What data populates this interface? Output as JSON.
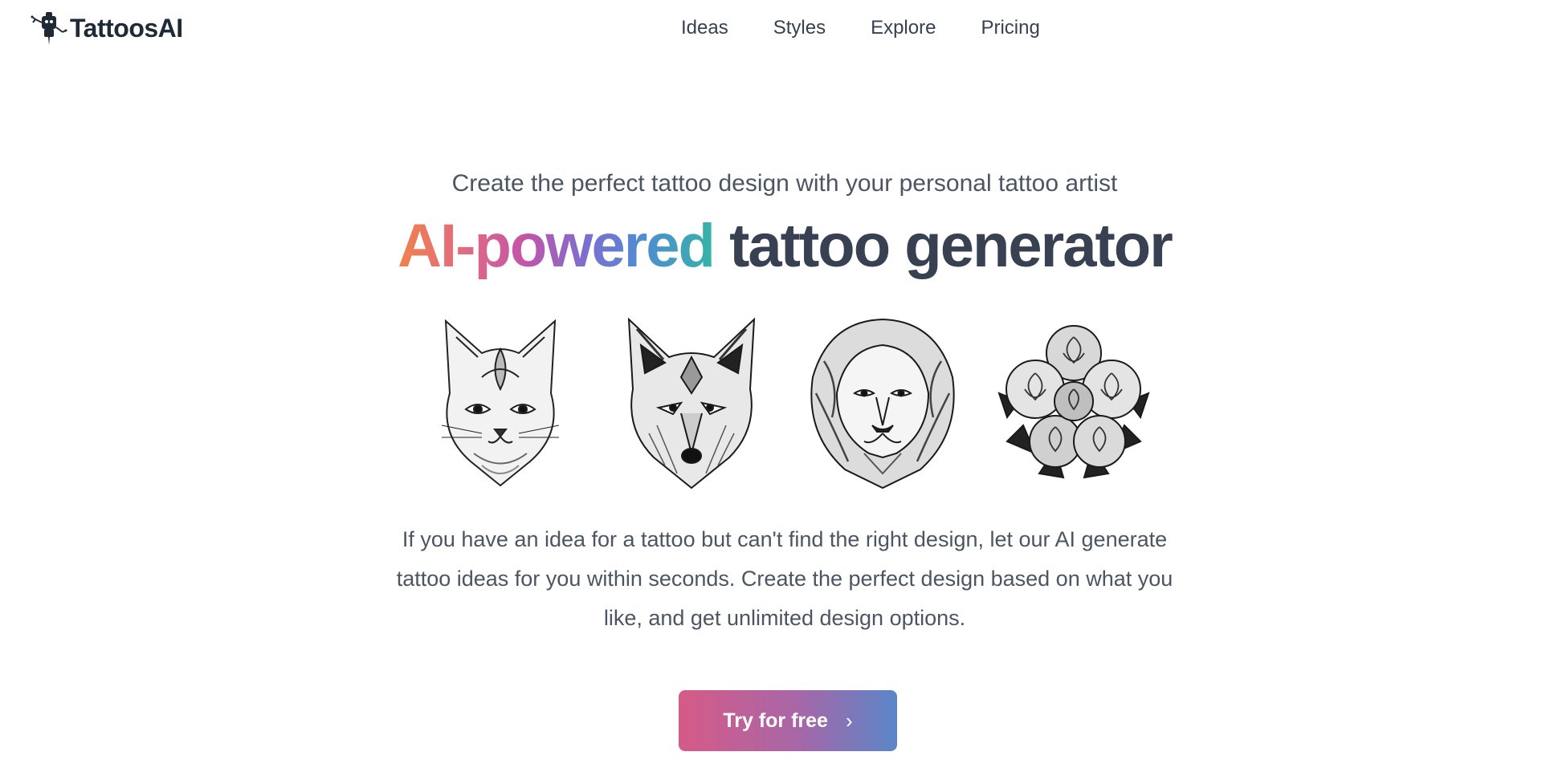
{
  "brand": {
    "name": "TattoosAI"
  },
  "nav": {
    "items": [
      "Ideas",
      "Styles",
      "Explore",
      "Pricing"
    ]
  },
  "hero": {
    "tagline": "Create the perfect tattoo design with your personal tattoo artist",
    "headline_gradient": "AI-powered",
    "headline_rest": "tattoo generator",
    "description": "If you have an idea for a tattoo but can't find the right design, let our AI generate tattoo ideas for you within seconds. Create the perfect design based on what you like, and get unlimited design options.",
    "cta_label": "Try for free",
    "cta_icon": "chevron-right-icon"
  },
  "gallery": {
    "items": [
      "cat",
      "wolf",
      "lion",
      "roses"
    ]
  },
  "colors": {
    "text_dark": "#374151",
    "gradient_start": "#f0824b",
    "gradient_end": "#35b4a6",
    "cta_start": "#d65a87",
    "cta_end": "#5a86c8"
  }
}
